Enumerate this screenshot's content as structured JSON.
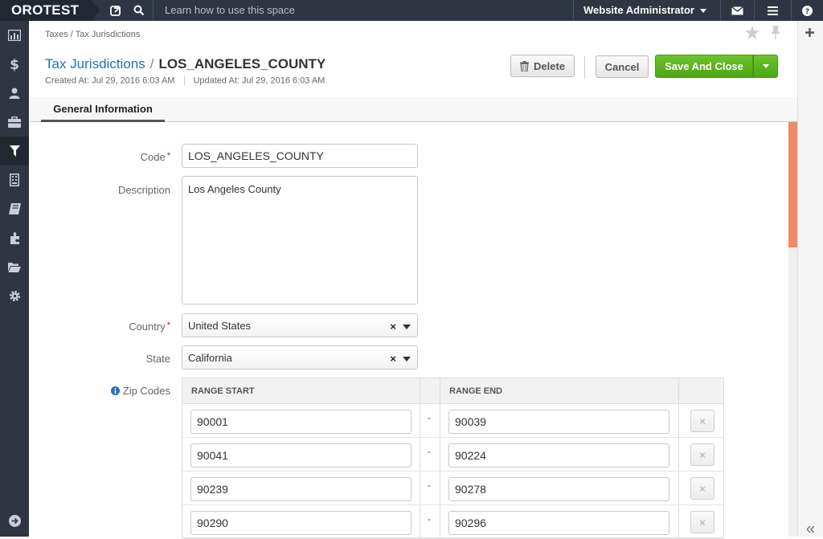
{
  "topbar": {
    "brand": "OROTEST",
    "search_placeholder": "Learn how to use this space",
    "user_menu": "Website Administrator",
    "icons": [
      "tasks-icon",
      "search-icon",
      "envelope-icon",
      "menu-icon",
      "help-icon"
    ]
  },
  "sidebar": {
    "items": [
      "dashboard-icon",
      "sales-icon",
      "customers-icon",
      "products-icon",
      "marketing-icon",
      "reports-icon",
      "taxes-icon",
      "system-icon",
      "settings-icon"
    ],
    "active": "marketing-icon"
  },
  "breadcrumb": "Taxes / Tax Jurisdictions",
  "header": {
    "entity_link": "Tax Jurisdictions",
    "separator": "/",
    "entity_name": "LOS_ANGELES_COUNTY",
    "created": "Created At: Jul 29, 2016 6:03 AM",
    "updated": "Updated At: Jul 29, 2016 6:03 AM"
  },
  "actions": {
    "delete": "Delete",
    "cancel": "Cancel",
    "save": "Save And Close"
  },
  "tabs": [
    "General Information"
  ],
  "form": {
    "code_label": "Code",
    "code_value": "LOS_ANGELES_COUNTY",
    "description_label": "Description",
    "description_value": "Los Angeles County",
    "country_label": "Country",
    "country_value": "United States",
    "state_label": "State",
    "state_value": "California",
    "zip_label": "Zip Codes",
    "required_mark": "*",
    "clear_mark": "×"
  },
  "zip_table": {
    "headers": [
      "RANGE START",
      "RANGE END"
    ],
    "range_dash": "-",
    "rows": [
      {
        "start": "90001",
        "end": "90039"
      },
      {
        "start": "90041",
        "end": "90224"
      },
      {
        "start": "90239",
        "end": "90278"
      },
      {
        "start": "90290",
        "end": "90296"
      }
    ]
  },
  "colors": {
    "topbar": "#2f3542",
    "link": "#2471b0",
    "save_green": "#5cb322",
    "scroll_accent": "#f08a64",
    "required": "#c6102b"
  }
}
